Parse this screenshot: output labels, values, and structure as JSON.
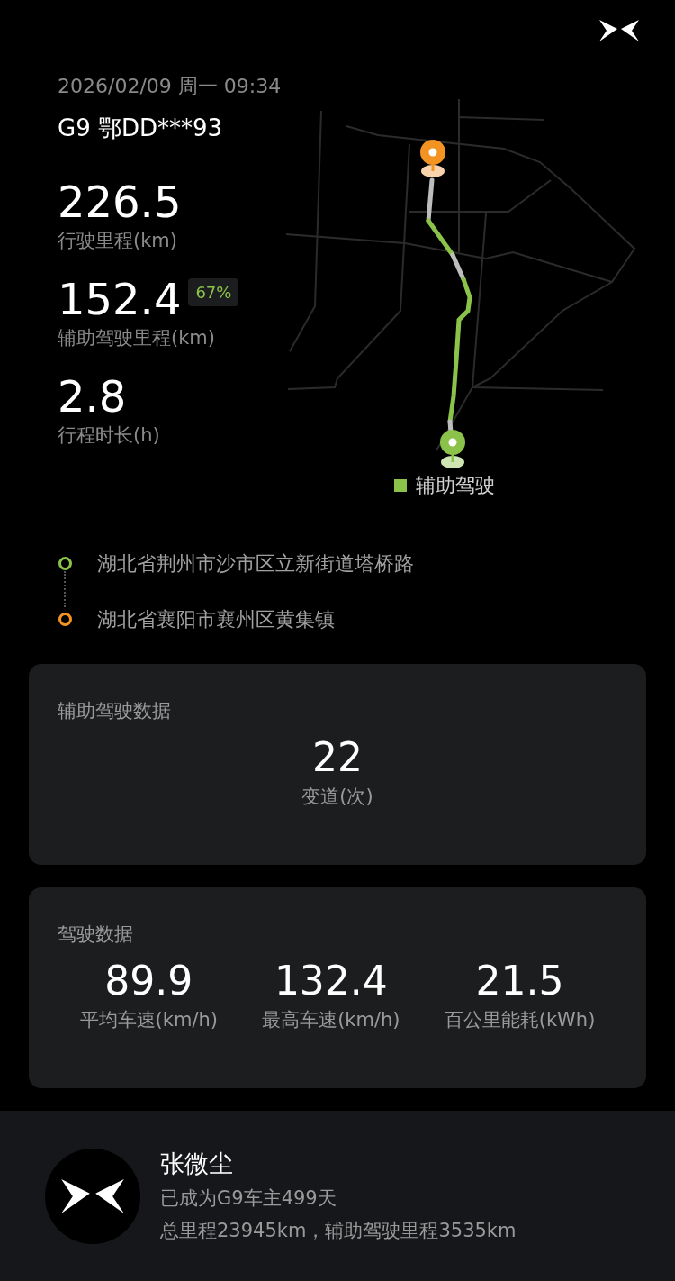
{
  "header": {
    "datetime": "2026/02/09 周一 09:34",
    "vehicle": "G9 鄂DD***93"
  },
  "stats": [
    {
      "value": "226.5",
      "label": "行驶里程(km)"
    },
    {
      "value": "152.4",
      "label": "辅助驾驶里程(km)",
      "badge": "67%"
    },
    {
      "value": "2.8",
      "label": "行程时长(h)"
    }
  ],
  "map": {
    "legend": [
      {
        "label": "辅助驾驶",
        "color": "#8bc34a"
      }
    ]
  },
  "route": [
    {
      "kind": "start",
      "address": "湖北省荆州市沙市区立新街道塔桥路",
      "color": "#8bc34a"
    },
    {
      "kind": "end",
      "address": "湖北省襄阳市襄州区黄集镇",
      "color": "#f39322"
    }
  ],
  "assist_card": {
    "title": "辅助驾驶数据",
    "metrics": [
      {
        "value": "22",
        "label": "变道(次)"
      }
    ]
  },
  "driving_card": {
    "title": "驾驶数据",
    "metrics": [
      {
        "value": "89.9",
        "label": "平均车速(km/h)"
      },
      {
        "value": "132.4",
        "label": "最高车速(km/h)"
      },
      {
        "value": "21.5",
        "label": "百公里能耗(kWh)"
      }
    ]
  },
  "owner": {
    "name": "张微尘",
    "lines": [
      "已成为G9车主499天",
      "总里程23945km，辅助驾驶里程3535km"
    ]
  }
}
